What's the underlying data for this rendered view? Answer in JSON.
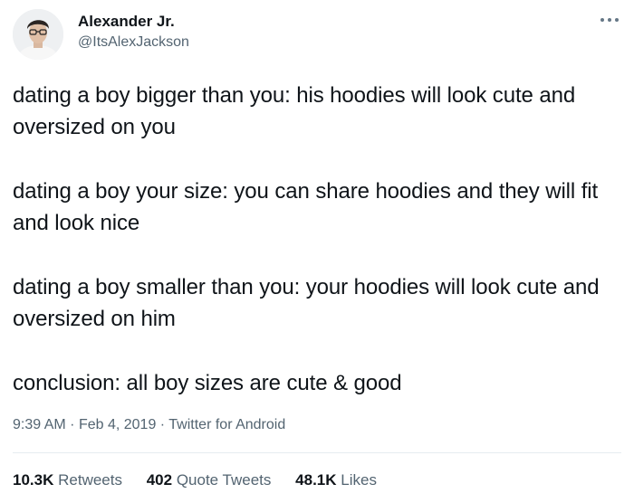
{
  "user": {
    "display_name": "Alexander Jr.",
    "handle": "@ItsAlexJackson",
    "avatar_icon": "profile-photo"
  },
  "tweet": {
    "paragraphs": [
      "dating a boy bigger than you: his hoodies will look cute and oversized on you",
      "dating a boy your size: you can share hoodies and they will fit and look nice",
      "dating a boy smaller than you: your hoodies will look cute and oversized on him",
      "conclusion: all boy sizes are cute & good"
    ],
    "time": "9:39 AM",
    "separator": "·",
    "date": "Feb 4, 2019",
    "source": "Twitter for Android"
  },
  "stats": {
    "retweets_count": "10.3K",
    "retweets_label": "Retweets",
    "quotes_count": "402",
    "quotes_label": "Quote Tweets",
    "likes_count": "48.1K",
    "likes_label": "Likes"
  },
  "colors": {
    "text": "#0f1419",
    "secondary": "#536471",
    "divider": "#e6ecf0"
  }
}
